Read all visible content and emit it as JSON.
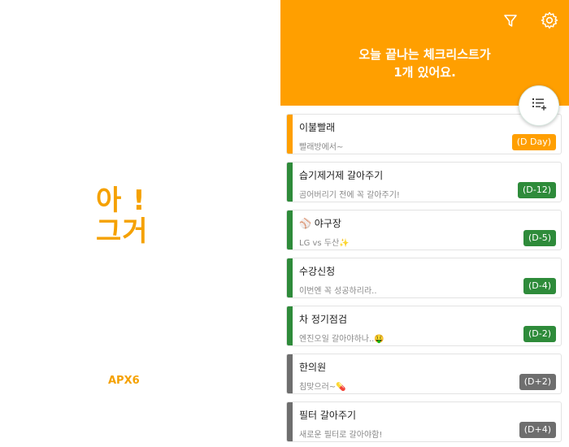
{
  "splash": {
    "logo_line1": "아 !",
    "logo_line2": "그거",
    "brand": "APX6"
  },
  "header": {
    "message_line1": "오늘 끝나는 체크리스트가",
    "message_line2": "1개 있어요."
  },
  "icons": {
    "filter": "filter-icon",
    "settings": "gear-icon",
    "add_list": "add-list-icon"
  },
  "colors": {
    "primary": "#FF9F00",
    "bar_today": "#FF9F00",
    "bar_upcoming": "#2E8B3A",
    "bar_past": "#6E6E6E",
    "badge_today": "#FF9F00",
    "badge_upcoming": "#2E8B3A",
    "badge_past": "#6E6E6E"
  },
  "checklist": [
    {
      "title": "이불빨래",
      "subtitle": "빨래방에서~",
      "badge": "(D Day)",
      "status": "today"
    },
    {
      "title": "습기제거제 갈아주기",
      "subtitle": "곰어버리기 전에 꼭 갈아주기!",
      "badge": "(D-12)",
      "status": "upcoming"
    },
    {
      "title": "⚾ 야구장",
      "subtitle": "LG vs 두산✨",
      "badge": "(D-5)",
      "status": "upcoming"
    },
    {
      "title": "수강신청",
      "subtitle": "이번엔 꼭 성공하리라..",
      "badge": "(D-4)",
      "status": "upcoming"
    },
    {
      "title": "차 정기점검",
      "subtitle": "엔진오일 갈아야하나..🤑",
      "badge": "(D-2)",
      "status": "upcoming"
    },
    {
      "title": "한의원",
      "subtitle": "침맞으러~💊",
      "badge": "(D+2)",
      "status": "past"
    },
    {
      "title": "필터 갈아주기",
      "subtitle": "새로운 필터로 갈아야함!",
      "badge": "(D+4)",
      "status": "past"
    }
  ]
}
